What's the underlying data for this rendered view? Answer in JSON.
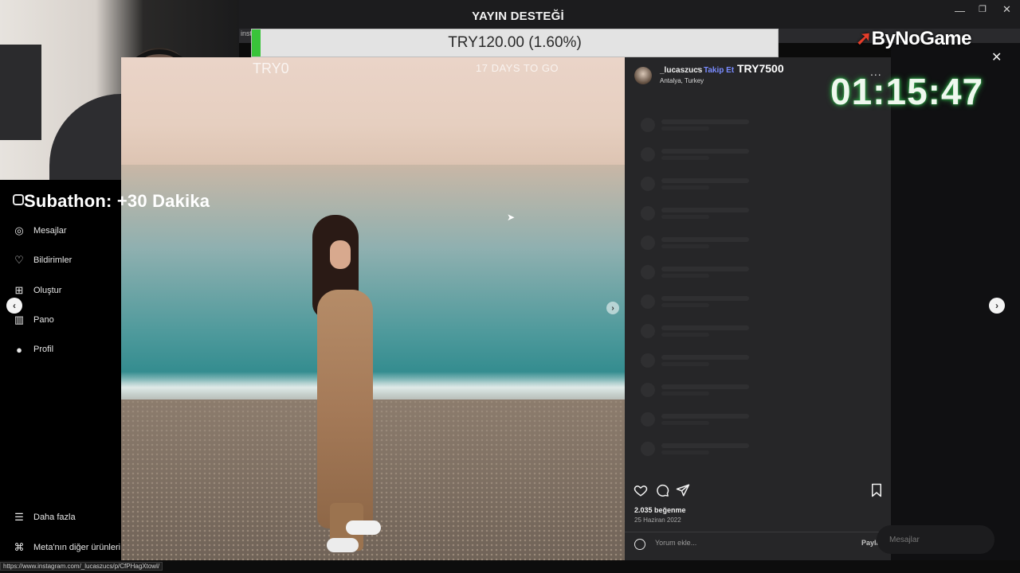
{
  "browser": {
    "title": "YAYIN DESTEĞİ",
    "tab_fragment": "inst",
    "status_url": "https://www.instagram.com/_lucaszucs/p/CfPHagXtowl/",
    "window_controls": [
      "—",
      "❐",
      "✕"
    ]
  },
  "donation_goal": {
    "label": "TRY120.00 (1.60%)",
    "progress_percent": 1.6,
    "current": "TRY0",
    "days_left": "17 DAYS TO GO",
    "fill_color": "#39c43a"
  },
  "overlay": {
    "subathon": "Subathon: +30 Dakika",
    "donation_amount": "TRY7500",
    "brand": "ByNoGame",
    "timer": "01:15:47",
    "timer_glow": "#2c9a42"
  },
  "sidebar": {
    "items": [
      {
        "label": "Mesajlar",
        "icon": "messenger-icon",
        "glyph": "◎"
      },
      {
        "label": "Bildirimler",
        "icon": "heart-icon",
        "glyph": "♡"
      },
      {
        "label": "Oluştur",
        "icon": "plus-square-icon",
        "glyph": "⊞"
      },
      {
        "label": "Pano",
        "icon": "dashboard-icon",
        "glyph": "▥"
      },
      {
        "label": "Profil",
        "icon": "profile-icon",
        "glyph": "●"
      }
    ],
    "more": {
      "label": "Daha fazla",
      "icon": "menu-icon",
      "glyph": "☰"
    },
    "meta": {
      "label": "Meta'nın diğer ürünleri",
      "icon": "meta-icon",
      "glyph": "⌘"
    }
  },
  "post": {
    "username": "_lucaszucs",
    "separator": "•",
    "follow_label": "Takip Et",
    "location": "Antalya, Turkey",
    "more_label": "...",
    "likes": "2.035 beğenme",
    "date": "25 Haziran 2022",
    "comment_placeholder": "Yorum ekle...",
    "share_label": "Paylaş",
    "accent": "#7a8cff"
  },
  "right": {
    "messages_label": "Mesajlar",
    "close_label": "✕"
  },
  "nav_arrows": {
    "prev": "‹",
    "next": "›"
  }
}
